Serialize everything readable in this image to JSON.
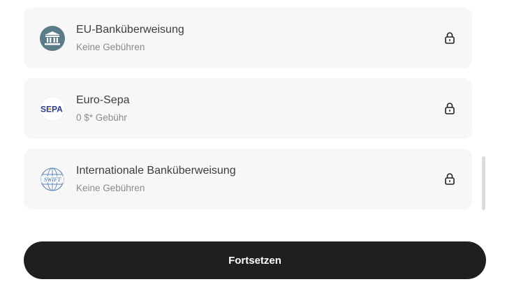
{
  "payment_methods": [
    {
      "name": "EU-Banküberweisung",
      "fee": "Keine Gebühren",
      "icon": "bank-building-icon",
      "logo_color": "#5b7b86",
      "locked": true
    },
    {
      "name": "Euro-Sepa",
      "fee": "0 $* Gebühr",
      "icon": "sepa-logo",
      "logo_text": "SEPA",
      "logo_color": "#2a3b8f",
      "accent_color": "#f0b400",
      "locked": true
    },
    {
      "name": "Internationale Banküberweisung",
      "fee": "Keine Gebühren",
      "icon": "swift-globe-icon",
      "logo_text": "SWIFT",
      "logo_color": "#3f6fa8",
      "locked": true
    }
  ],
  "continue_button": {
    "label": "Fortsetzen"
  },
  "colors": {
    "card_bg": "#f7f7f7",
    "button_bg": "#1f1f1f",
    "button_text": "#ffffff"
  }
}
